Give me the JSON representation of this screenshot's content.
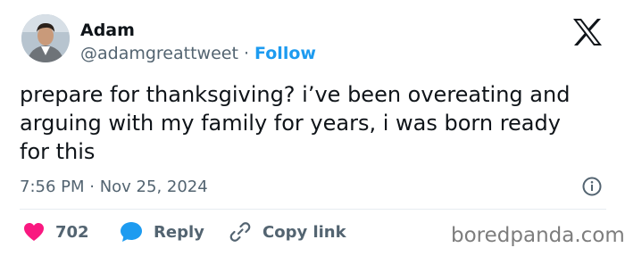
{
  "author": {
    "name": "Adam",
    "handle": "@adamgreattweet",
    "separator": " · ",
    "follow_label": "Follow"
  },
  "tweet": {
    "text": "prepare for thanksgiving? i’ve been overeating and\narguing with my family for years, i was born ready\nfor this",
    "timestamp": "7:56 PM · Nov 25, 2024"
  },
  "actions": {
    "like_count": "702",
    "reply_label": "Reply",
    "copy_link_label": "Copy link"
  },
  "watermark": "boredpanda.com",
  "colors": {
    "accent": "#1d9bf0",
    "like": "#f91880",
    "text": "#0f1419",
    "muted": "#536471"
  },
  "icons": {
    "logo": "x-logo-icon",
    "info": "info-icon",
    "like": "heart-icon",
    "reply": "speech-bubble-icon",
    "copy_link": "link-icon"
  }
}
